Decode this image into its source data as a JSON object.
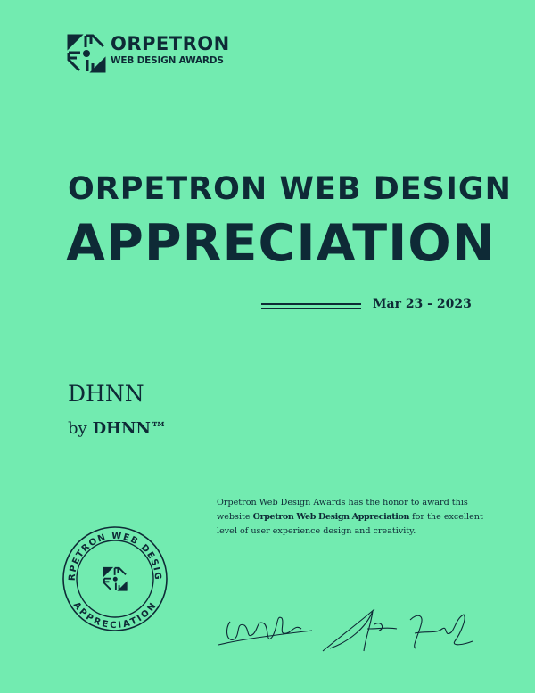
{
  "logo": {
    "name": "ORPETRON",
    "subtitle": "WEB DESIGN AWARDS",
    "icon": "orpetron-logo-icon"
  },
  "title": {
    "line1": "ORPETRON WEB DESIGN",
    "line2": "APPRECIATION"
  },
  "date": "Mar 23 - 2023",
  "recipient": {
    "name": "DHNN",
    "by_prefix": "by",
    "by_name": "DHNN™"
  },
  "description": {
    "before": "Orpetron Web Design Awards has the honor to award this website ",
    "bold": "Orpetron Web Design Appreciation",
    "after": " for the excellent level of user experience design and creativity."
  },
  "seal": {
    "top_text": "ORPETRON WEB DESIGN",
    "bottom_text": "APPRECIATION"
  },
  "colors": {
    "background": "#72ebb0",
    "ink": "#0e2a36"
  }
}
